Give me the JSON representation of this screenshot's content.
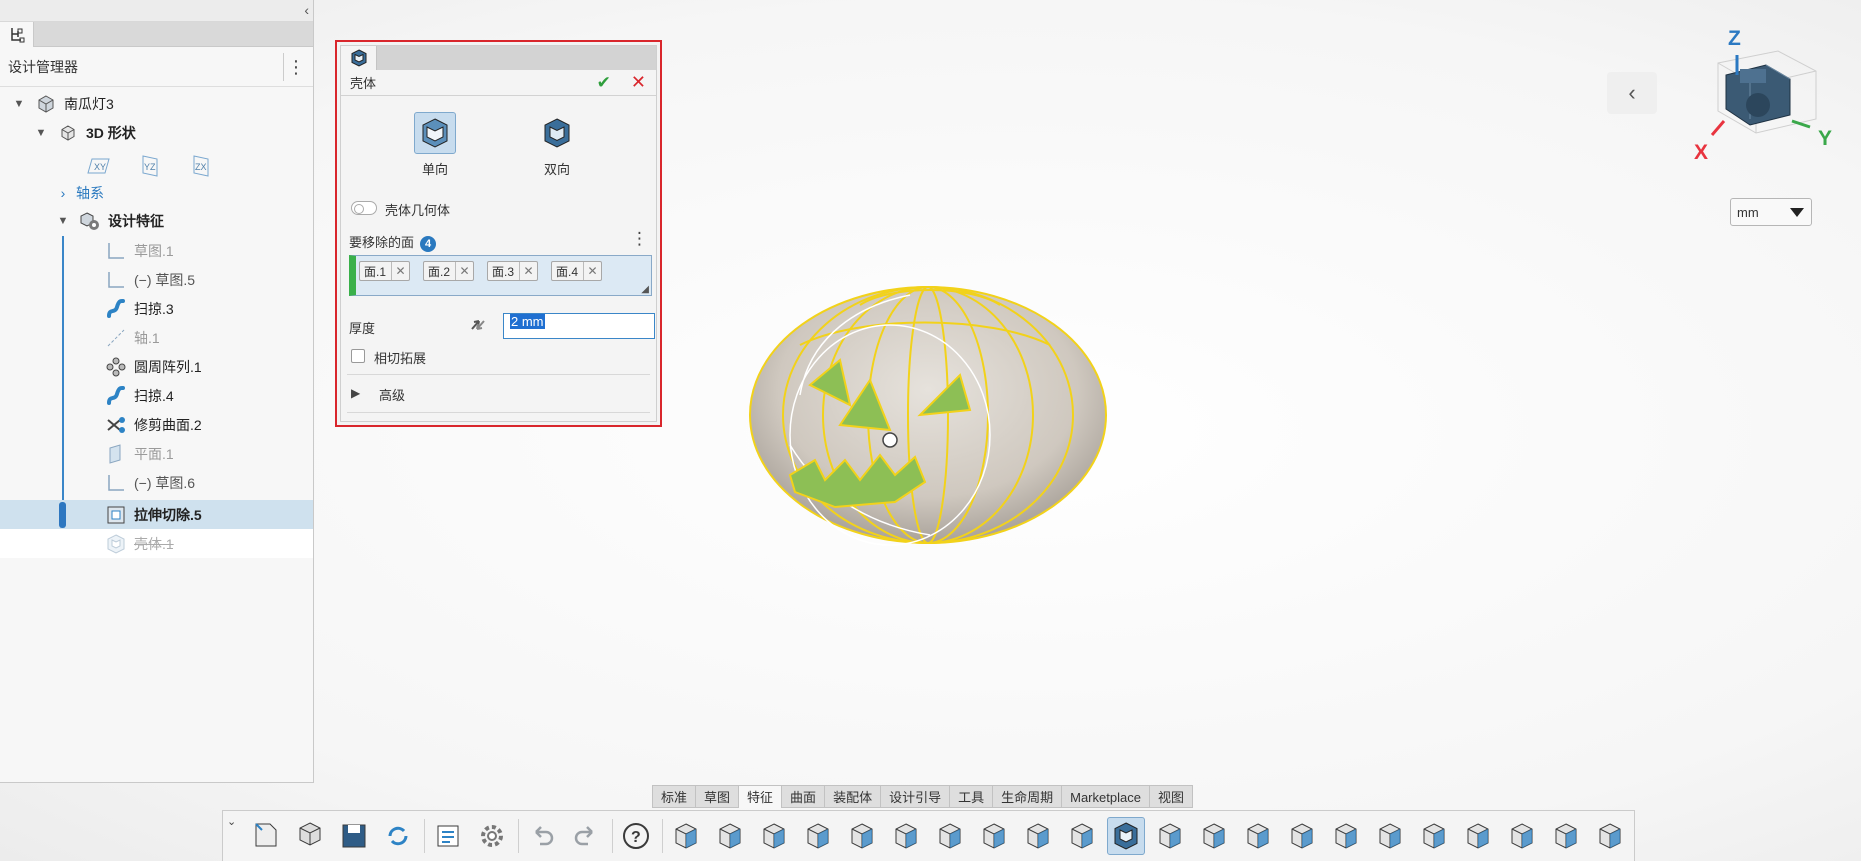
{
  "tree_panel": {
    "header_title": "设计管理器",
    "items": [
      {
        "label": "南瓜灯3",
        "icon": "part-icon"
      },
      {
        "label": "3D 形状",
        "icon": "shape-icon"
      },
      {
        "label": "轴系",
        "icon": "axis-system-icon"
      },
      {
        "label": "设计特征",
        "icon": "design-features-icon"
      },
      {
        "label": "草图.1",
        "icon": "sketch-icon"
      },
      {
        "label": "(−)  草图.5",
        "icon": "sketch-icon"
      },
      {
        "label": "扫掠.3",
        "icon": "sweep-icon"
      },
      {
        "label": "轴.1",
        "icon": "axis-icon"
      },
      {
        "label": "圆周阵列.1",
        "icon": "circular-pattern-icon"
      },
      {
        "label": "扫掠.4",
        "icon": "sweep-icon"
      },
      {
        "label": "修剪曲面.2",
        "icon": "trim-surface-icon"
      },
      {
        "label": "平面.1",
        "icon": "plane-icon"
      },
      {
        "label": "(−)  草图.6",
        "icon": "sketch-icon"
      },
      {
        "label": "拉伸切除.5",
        "icon": "extrude-cut-icon"
      },
      {
        "label": "壳体.1",
        "icon": "shell-icon"
      }
    ],
    "planes": [
      "XY",
      "YZ",
      "ZX"
    ]
  },
  "shell_dialog": {
    "title": "壳体",
    "modes": [
      {
        "label": "单向",
        "active": true
      },
      {
        "label": "双向",
        "active": false
      }
    ],
    "toggle_label": "壳体几何体",
    "faces_label": "要移除的面",
    "faces_count": "4",
    "faces": [
      "面.1",
      "面.2",
      "面.3",
      "面.4"
    ],
    "thickness_label": "厚度",
    "thickness_value": "2 mm",
    "tangent_label": "相切拓展",
    "advanced_label": "高级"
  },
  "viewport": {
    "unit": "mm",
    "axes": {
      "x": "X",
      "y": "Y",
      "z": "Z"
    },
    "colors": {
      "x": "#e8343f",
      "y": "#3aa84a",
      "z": "#2b79c2",
      "highlight": "#f2d21a"
    }
  },
  "ribbon": {
    "tabs": [
      {
        "label": "标准",
        "active": false
      },
      {
        "label": "草图",
        "active": false
      },
      {
        "label": "特征",
        "active": true
      },
      {
        "label": "曲面",
        "active": false
      },
      {
        "label": "装配体",
        "active": false
      },
      {
        "label": "设计引导",
        "active": false
      },
      {
        "label": "工具",
        "active": false
      },
      {
        "label": "生命周期",
        "active": false
      },
      {
        "label": "Marketplace",
        "active": false
      },
      {
        "label": "视图",
        "active": false
      }
    ],
    "tools": [
      "new-doc-icon",
      "open-icon",
      "save-icon",
      "regenerate-icon",
      "properties-icon",
      "settings-icon",
      "undo-icon",
      "redo-icon",
      "help-icon",
      "extrude-icon",
      "revolve-icon",
      "extrude-cut-icon",
      "sweep-icon",
      "sweep-cut-icon",
      "loft-icon",
      "fillet-icon",
      "chamfer-icon",
      "draft-icon",
      "rib-icon",
      "shell-icon",
      "move-face-icon",
      "mirror-icon",
      "pattern-icon",
      "wrap-icon",
      "split-icon",
      "combine-icon",
      "scale-icon",
      "delete-body-icon",
      "move-body-icon",
      "dome-icon",
      "thicken-icon"
    ]
  }
}
